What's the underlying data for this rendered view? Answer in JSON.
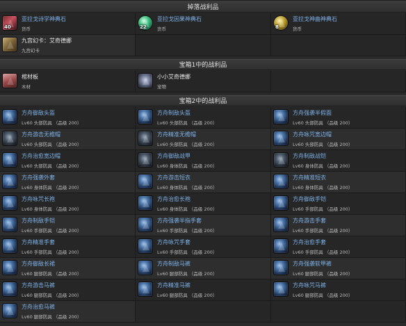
{
  "sections": {
    "drop": "掉落战利品",
    "chest1": "宝箱1中的战利品",
    "chest2": "宝箱2中的战利品"
  },
  "drop_items": [
    {
      "name": "亚拉戈诗学神典石",
      "sub": "货币",
      "qty": "40",
      "icon": "tome-book-icon"
    },
    {
      "name": "亚拉戈因果神典石",
      "sub": "货币",
      "qty": "22",
      "icon": "tome-coin-icon"
    },
    {
      "name": "亚拉戈神曲神典石",
      "sub": "货币",
      "qty": "8",
      "icon": "tome-gear-icon"
    },
    {
      "name": "九宫幻卡：艾奇德娜",
      "sub": "九宫幻卡",
      "qty": "",
      "icon": "triple-triad-card-icon"
    }
  ],
  "chest1_items": [
    {
      "name": "棺材板",
      "sub": "木材",
      "icon": "wood-plank-icon"
    },
    {
      "name": "小小艾奇德娜",
      "sub": "宠物",
      "icon": "minion-icon"
    }
  ],
  "chest2_items": [
    {
      "name": "方舟御敌头盔",
      "sub": "Lv60 头部防具 （品级 200）",
      "icon": "helmet-icon"
    },
    {
      "name": "方舟制敌头盔",
      "sub": "Lv60 头部防具 （品级 200）",
      "icon": "helmet-icon"
    },
    {
      "name": "方舟强袭半假面",
      "sub": "Lv60 头部防具 （品级 200）",
      "icon": "half-mask-icon"
    },
    {
      "name": "方舟游击无檐帽",
      "sub": "Lv60 头部防具 （品级 200）",
      "icon": "brimless-hat-icon"
    },
    {
      "name": "方舟精准无檐帽",
      "sub": "Lv60 头部防具 （品级 200）",
      "icon": "brimless-hat-icon"
    },
    {
      "name": "方舟咏咒宽边帽",
      "sub": "Lv60 头部防具 （品级 200）",
      "icon": "wide-brim-hat-icon"
    },
    {
      "name": "方舟治愈宽边帽",
      "sub": "Lv60 头部防具 （品级 200）",
      "icon": "wide-brim-hat-icon"
    },
    {
      "name": "方舟御敌战甲",
      "sub": "Lv60 身体防具 （品级 200）",
      "icon": "body-armor-icon"
    },
    {
      "name": "方舟制敌战铠",
      "sub": "Lv60 身体防具 （品级 200）",
      "icon": "body-armor-icon"
    },
    {
      "name": "方舟强袭外套",
      "sub": "Lv60 身体防具 （品级 200）",
      "icon": "coat-icon"
    },
    {
      "name": "方舟游击短衣",
      "sub": "Lv60 身体防具 （品级 200）",
      "icon": "tunic-icon"
    },
    {
      "name": "方舟精准短衣",
      "sub": "Lv60 身体防具 （品级 200）",
      "icon": "tunic-icon"
    },
    {
      "name": "方舟咏咒长袍",
      "sub": "Lv60 身体防具 （品级 200）",
      "icon": "robe-icon"
    },
    {
      "name": "方舟治愈长袍",
      "sub": "Lv60 身体防具 （品级 200）",
      "icon": "robe-icon"
    },
    {
      "name": "方舟御敌手铠",
      "sub": "Lv60 手部防具 （品级 200）",
      "icon": "gauntlet-icon"
    },
    {
      "name": "方舟制敌手铠",
      "sub": "Lv60 手部防具 （品级 200）",
      "icon": "gauntlet-icon"
    },
    {
      "name": "方舟强袭半指手套",
      "sub": "Lv60 手部防具 （品级 200）",
      "icon": "glove-icon"
    },
    {
      "name": "方舟游击手套",
      "sub": "Lv60 手部防具 （品级 200）",
      "icon": "glove-icon"
    },
    {
      "name": "方舟精准手套",
      "sub": "Lv60 手部防具 （品级 200）",
      "icon": "glove-icon"
    },
    {
      "name": "方舟咏咒手套",
      "sub": "Lv60 手部防具 （品级 200）",
      "icon": "glove-icon"
    },
    {
      "name": "方舟治愈手套",
      "sub": "Lv60 手部防具 （品级 200）",
      "icon": "glove-icon"
    },
    {
      "name": "方舟御敌长裙",
      "sub": "Lv60 腿部防具 （品级 200）",
      "icon": "skirt-icon"
    },
    {
      "name": "方舟制敌马裤",
      "sub": "Lv60 腿部防具 （品级 200）",
      "icon": "breeches-icon"
    },
    {
      "name": "方舟强袭软甲裤",
      "sub": "Lv60 腿部防具 （品级 200）",
      "icon": "breeches-icon"
    },
    {
      "name": "方舟游击马裤",
      "sub": "Lv60 腿部防具 （品级 200）",
      "icon": "breeches-icon"
    },
    {
      "name": "方舟精准马裤",
      "sub": "Lv60 腿部防具 （品级 200）",
      "icon": "breeches-icon"
    },
    {
      "name": "方舟咏咒马裤",
      "sub": "Lv60 腿部防具 （品级 200）",
      "icon": "breeches-icon"
    },
    {
      "name": "方舟治愈马裤",
      "sub": "Lv60 腿部防具 （品级 200）",
      "icon": "breeches-icon"
    }
  ]
}
